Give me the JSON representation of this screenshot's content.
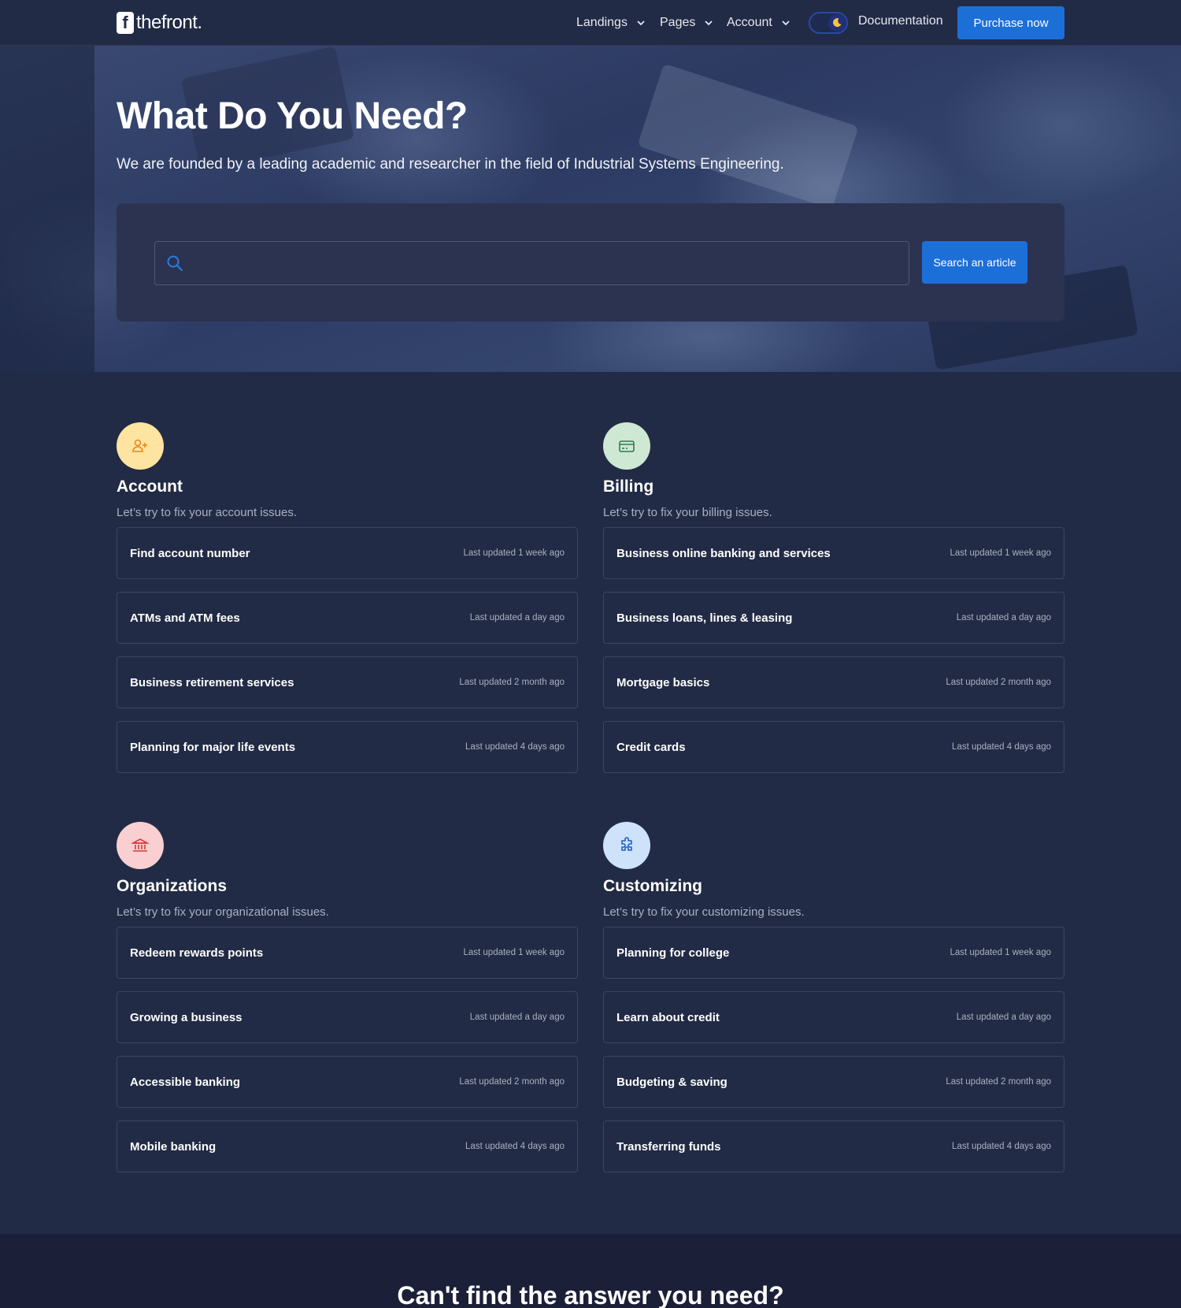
{
  "header": {
    "logo_text": "thefront.",
    "logo_mark": "f",
    "nav": [
      "Landings",
      "Pages",
      "Account"
    ],
    "theme_toggle_icon": "moon-icon",
    "documentation": "Documentation",
    "purchase": "Purchase now"
  },
  "hero": {
    "title": "What Do You Need?",
    "subtitle": "We are founded by a leading academic and researcher in the field of Industrial Systems Engineering.",
    "search_placeholder": "",
    "search_button": "Search an article"
  },
  "categories": [
    {
      "icon": "user-plus-icon",
      "icon_bg": "#fde4a0",
      "icon_color": "#e8881a",
      "title": "Account",
      "description": "Let’s try to fix your account issues.",
      "items": [
        {
          "title": "Find account number",
          "date": "Last updated 1 week ago"
        },
        {
          "title": "ATMs and ATM fees",
          "date": "Last updated a day ago"
        },
        {
          "title": "Business retirement services",
          "date": "Last updated 2 month ago"
        },
        {
          "title": "Planning for major life events",
          "date": "Last updated 4 days ago"
        }
      ]
    },
    {
      "icon": "credit-card-icon",
      "icon_bg": "#cfe8d3",
      "icon_color": "#2e7d4f",
      "title": "Billing",
      "description": "Let’s try to fix your billing issues.",
      "items": [
        {
          "title": "Business online banking and services",
          "date": "Last updated 1 week ago"
        },
        {
          "title": "Business loans, lines & leasing",
          "date": "Last updated a day ago"
        },
        {
          "title": "Mortgage basics",
          "date": "Last updated 2 month ago"
        },
        {
          "title": "Credit cards",
          "date": "Last updated 4 days ago"
        }
      ]
    },
    {
      "icon": "bank-icon",
      "icon_bg": "#f9cfd1",
      "icon_color": "#d33b3b",
      "title": "Organizations",
      "description": "Let’s try to fix your organizational issues.",
      "items": [
        {
          "title": "Redeem rewards points",
          "date": "Last updated 1 week ago"
        },
        {
          "title": "Growing a business",
          "date": "Last updated a day ago"
        },
        {
          "title": "Accessible banking",
          "date": "Last updated 2 month ago"
        },
        {
          "title": "Mobile banking",
          "date": "Last updated 4 days ago"
        }
      ]
    },
    {
      "icon": "puzzle-icon",
      "icon_bg": "#cfe2fb",
      "icon_color": "#1d5fc0",
      "title": "Customizing",
      "description": "Let’s try to fix your customizing issues.",
      "items": [
        {
          "title": "Planning for college",
          "date": "Last updated 1 week ago"
        },
        {
          "title": "Learn about credit",
          "date": "Last updated a day ago"
        },
        {
          "title": "Budgeting & saving",
          "date": "Last updated 2 month ago"
        },
        {
          "title": "Transferring funds",
          "date": "Last updated 4 days ago"
        }
      ]
    }
  ],
  "bottom": {
    "title": "Can't find the answer you need?"
  },
  "colors": {
    "background": "#222b45",
    "accent": "#1d6fd8",
    "card_border": "#3b4463",
    "muted_text": "#aab0c0"
  }
}
